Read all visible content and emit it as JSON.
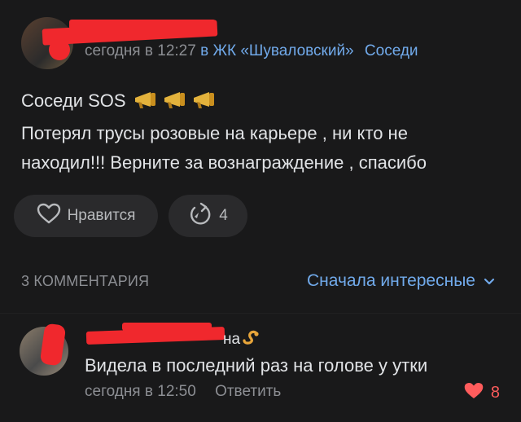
{
  "post": {
    "author_redacted": true,
    "time": "сегодня в 12:27",
    "in_word": "в",
    "group": "ЖК «Шуваловский»",
    "category": "Соседи",
    "line1": "Соседи SOS",
    "line2": "Потерял трусы розовые на карьере , ни кто не",
    "line3": "находил!!! Верните за вознаграждение , спасибо",
    "emoji_icon": "megaphone-icon",
    "like_label": "Нравится",
    "share_count": "4"
  },
  "comments_header": {
    "count_label": "3 КОММЕНТАРИЯ",
    "sort_label": "Сначала интересные"
  },
  "comment": {
    "name_suffix": "на",
    "text": "Видела в последний раз на голове у утки",
    "time": "сегодня в 12:50",
    "reply_label": "Ответить",
    "likes": "8"
  },
  "colors": {
    "background": "#19191a",
    "link": "#71aaeb",
    "redaction": "#f0282d",
    "like_heart": "#ff5c5c"
  }
}
